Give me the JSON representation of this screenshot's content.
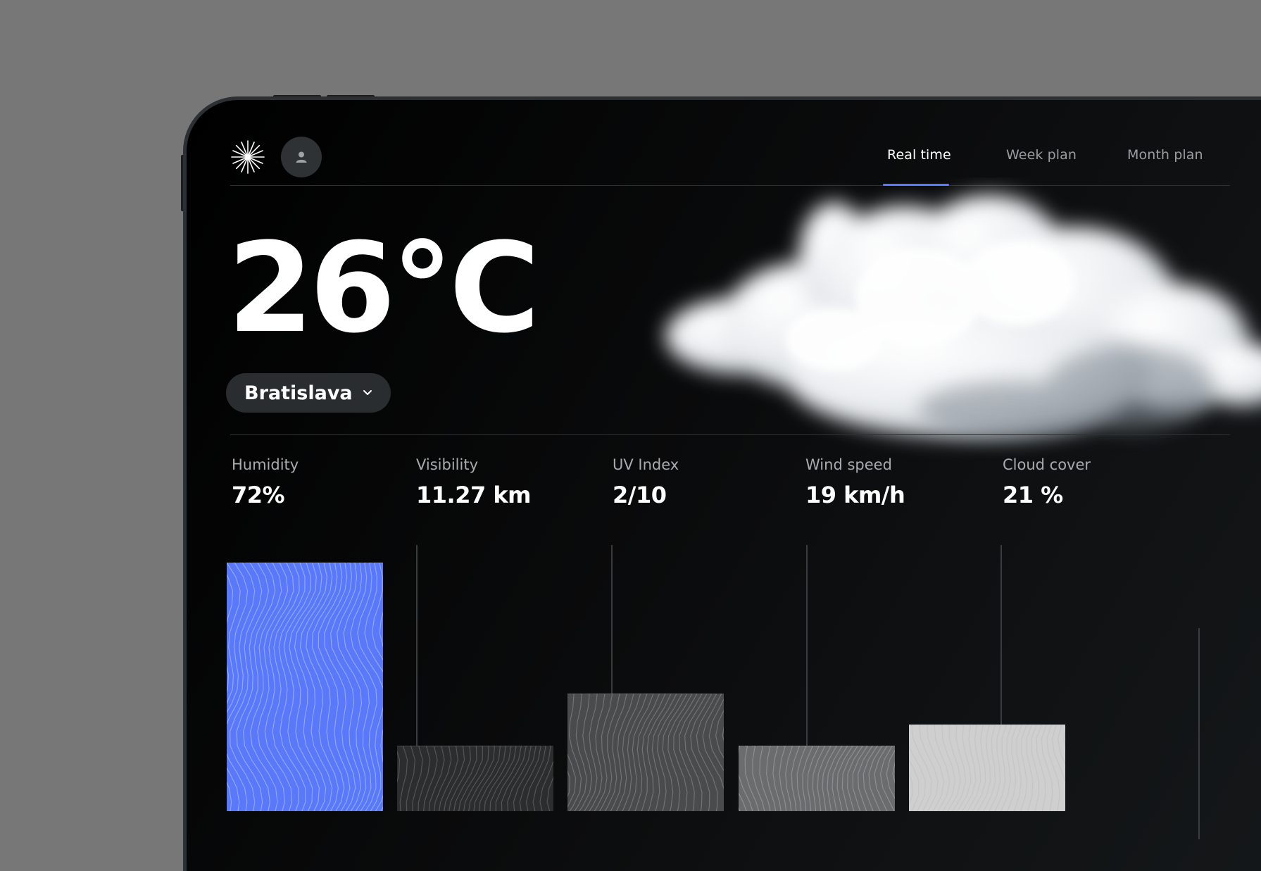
{
  "header": {
    "logo_icon": "asterisk-burst-icon",
    "avatar_icon": "user-icon",
    "tabs": [
      {
        "label": "Real time",
        "active": true
      },
      {
        "label": "Week plan",
        "active": false
      },
      {
        "label": "Month plan",
        "active": false
      }
    ],
    "accent_color": "#5b78ff"
  },
  "weather": {
    "temperature": "26°C",
    "city": "Bratislava",
    "city_dropdown_icon": "chevron-down-icon",
    "condition_icon": "cloud-icon"
  },
  "stats": [
    {
      "label": "Humidity",
      "value": "72%"
    },
    {
      "label": "Visibility",
      "value": "11.27 km"
    },
    {
      "label": "UV Index",
      "value": "2/10"
    },
    {
      "label": "Wind speed",
      "value": "19 km/h"
    },
    {
      "label": "Cloud cover",
      "value": "21 %"
    }
  ],
  "bars": {
    "highlight_color": "#5a78fa",
    "levels": [
      0.72,
      0.19,
      0.34,
      0.19,
      0.25
    ]
  }
}
